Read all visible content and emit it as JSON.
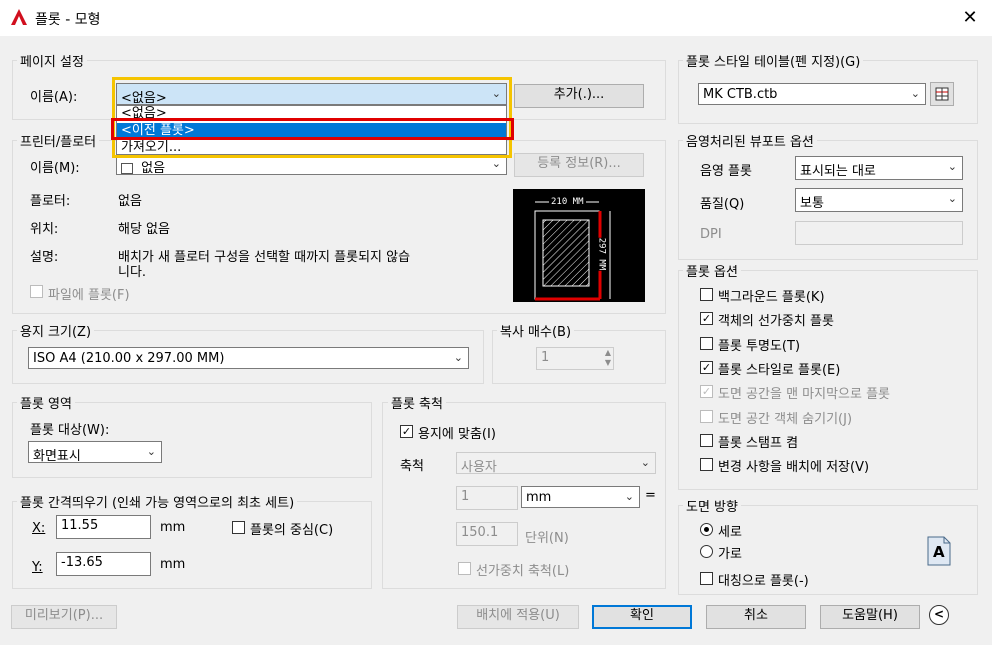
{
  "window": {
    "title": "플롯 - 모형",
    "close": "✕"
  },
  "page_setup": {
    "group": "페이지 설정",
    "name_label": "이름(A):",
    "name_value": "<없음>",
    "add_button": "추가(.)...",
    "dropdown_options": [
      "<없음>",
      "<이전 플롯>",
      "가져오기..."
    ],
    "selected_index": 1
  },
  "printer": {
    "group": "프린터/플로터",
    "name_label": "이름(M):",
    "name_value": "없음",
    "properties_button": "등록 정보(R)...",
    "plotter_label": "플로터:",
    "plotter_value": "없음",
    "location_label": "위치:",
    "location_value": "해당 없음",
    "description_label": "설명:",
    "description_value_1": "배치가 새 플로터 구성을 선택할 때까지 플롯되지 않습",
    "description_value_2": "니다.",
    "plot_to_file": "파일에 플롯(F)"
  },
  "preview_sheet": {
    "width": "210 MM",
    "height": "297 MM"
  },
  "paper_size": {
    "group": "용지 크기(Z)",
    "value": "ISO A4 (210.00 x 297.00 MM)"
  },
  "copies": {
    "group": "복사 매수(B)",
    "value": "1"
  },
  "plot_area": {
    "group": "플롯 영역",
    "what_label": "플롯 대상(W):",
    "what_value": "화면표시"
  },
  "plot_offset": {
    "group": "플롯 간격띄우기 (인쇄 가능 영역으로의 최초 세트)",
    "x_label": "X:",
    "x_value": "11.55",
    "x_unit": "mm",
    "y_label": "Y:",
    "y_value": "-13.65",
    "y_unit": "mm",
    "center_label": "플롯의 중심(C)"
  },
  "plot_scale": {
    "group": "플롯 축척",
    "fit_label": "용지에 맞춤(I)",
    "scale_label": "축척",
    "scale_value": "사용자",
    "value1": "1",
    "unit_value": "mm",
    "equals": "=",
    "value2": "150.1",
    "unit_label": "단위(N)",
    "lineweights_label": "선가중치 축척(L)"
  },
  "plot_style_table": {
    "group": "플롯 스타일 테이블(펜 지정)(G)",
    "value": "MK CTB.ctb"
  },
  "shaded_viewport": {
    "group": "음영처리된 뷰포트 옵션",
    "shade_label": "음영 플롯",
    "shade_value": "표시되는 대로",
    "quality_label": "품질(Q)",
    "quality_value": "보통",
    "dpi_label": "DPI"
  },
  "plot_options": {
    "group": "플롯 옵션",
    "items": [
      {
        "label": "백그라운드 플롯(K)",
        "checked": false,
        "disabled": false
      },
      {
        "label": "객체의 선가중치 플롯",
        "checked": true,
        "disabled": false
      },
      {
        "label": "플롯 투명도(T)",
        "checked": false,
        "disabled": false
      },
      {
        "label": "플롯 스타일로 플롯(E)",
        "checked": true,
        "disabled": false
      },
      {
        "label": "도면 공간을 맨 마지막으로 플롯",
        "checked": true,
        "disabled": true
      },
      {
        "label": "도면 공간 객체 숨기기(J)",
        "checked": false,
        "disabled": true
      },
      {
        "label": "플롯 스탬프 켬",
        "checked": false,
        "disabled": false
      },
      {
        "label": "변경 사항을 배치에 저장(V)",
        "checked": false,
        "disabled": false
      }
    ]
  },
  "orientation": {
    "group": "도면 방향",
    "portrait": "세로",
    "landscape": "가로",
    "upside_down": "대칭으로 플롯(-)",
    "icon_letter": "A"
  },
  "footer": {
    "preview": "미리보기(P)...",
    "apply": "배치에 적용(U)",
    "ok": "확인",
    "cancel": "취소",
    "help": "도움말(H)",
    "collapse_icon": "<"
  },
  "colors": {
    "accent": "#0078d7",
    "highlight_yellow": "#f5c400",
    "highlight_red": "#e00000"
  }
}
